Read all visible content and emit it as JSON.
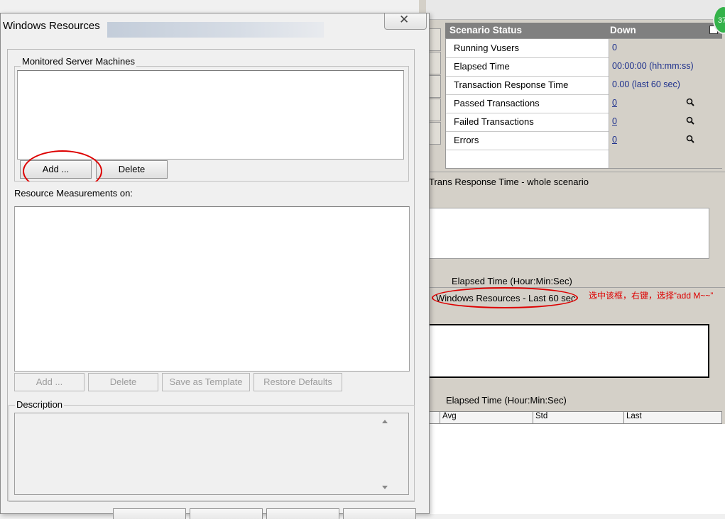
{
  "dialog": {
    "title": "Windows Resources",
    "monitored_group_label": "Monitored Server Machines",
    "add_label": "Add ...",
    "delete_label": "Delete",
    "measurements_label": "Resource Measurements on:",
    "m_add_label": "Add ...",
    "m_delete_label": "Delete",
    "save_template_label": "Save as Template",
    "restore_defaults_label": "Restore Defaults",
    "description_label": "Description"
  },
  "status": {
    "header_title": "Scenario Status",
    "header_value": "Down",
    "rows": [
      {
        "label": "Running Vusers",
        "value": "0"
      },
      {
        "label": "Elapsed Time",
        "value": "00:00:00 (hh:mm:ss)"
      },
      {
        "label": "Transaction Response Time",
        "value": "0.00 (last 60 sec)"
      },
      {
        "label": "Passed Transactions",
        "value": "0"
      },
      {
        "label": "Failed Transactions",
        "value": "0"
      },
      {
        "label": "Errors",
        "value": "0"
      }
    ]
  },
  "graphs": {
    "trans_title": "Trans Response Time - whole scenario",
    "elapsed_label_1": "Elapsed Time (Hour:Min:Sec)",
    "windows_title": "Windows Resources - Last 60 sec",
    "elapsed_label_2": "Elapsed Time (Hour:Min:Sec)"
  },
  "annotation": {
    "text": "选中该框，右键，选择“add M~~”"
  },
  "grid": {
    "columns": [
      "Avg",
      "Std",
      "Last"
    ]
  },
  "badge": {
    "text": "37"
  },
  "colors": {
    "annotation_red": "#dd0000",
    "link_blue": "#1c2f8c",
    "status_header_bg": "#808080",
    "badge_green": "#34b24a"
  }
}
